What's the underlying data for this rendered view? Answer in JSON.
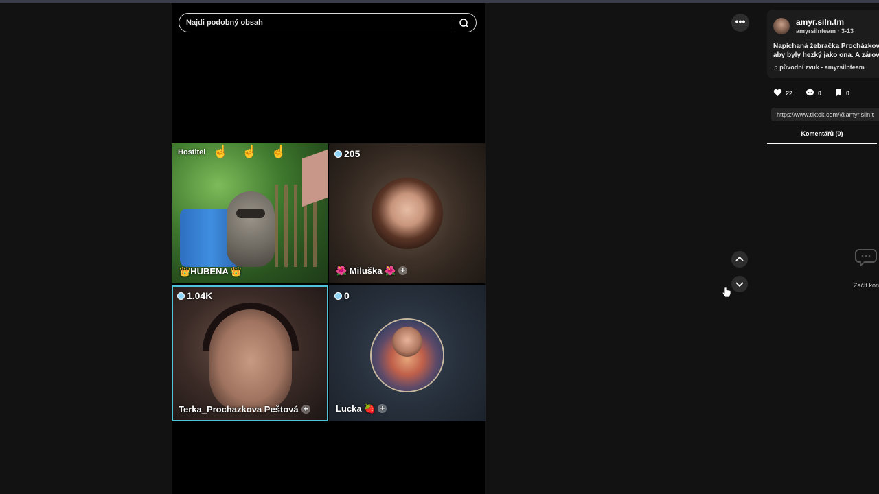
{
  "search": {
    "placeholder": "Najdi podobný obsah"
  },
  "live": {
    "host_label": "Hostitel",
    "tiles": [
      {
        "name": "👑HUBENA 👑"
      },
      {
        "count": "205",
        "name": "🌺 Miluška 🌺"
      },
      {
        "count": "1.04K",
        "name": "Terka_Prochazkova Peštová"
      },
      {
        "count": "0",
        "name": "Lucka 🍓"
      }
    ]
  },
  "post": {
    "username": "amyr.siln.tm",
    "meta": "amyrsilnteam · 3-13",
    "description_line1": "Napíchaná žebračka Procházkova",
    "description_line2": "aby byly hezký jako ona. A zárov",
    "music": "původní zvuk - amyrsilnteam",
    "likes": "22",
    "comments": "0",
    "saves": "0",
    "url": "https://www.tiktok.com/@amyr.siln.t",
    "comments_tab": "Komentářů (0)",
    "empty_text": "Začít kon"
  }
}
